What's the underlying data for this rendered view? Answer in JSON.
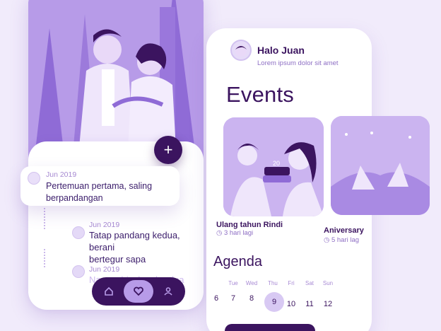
{
  "timeline": {
    "items": [
      {
        "date": "Jun 2019",
        "title_line1": "Pertemuan pertama, saling",
        "title_line2": "berpandangan"
      },
      {
        "date": "Jun 2019",
        "title_line1": "Tatap pandang kedua, berani",
        "title_line2": "bertegur sapa"
      },
      {
        "date": "Jun 2019",
        "title_line1": "Naman bioskop berdua",
        "title_line2": ""
      }
    ],
    "fab_label": "+"
  },
  "profile": {
    "name": "Halo Juan",
    "subtitle": "Lorem ipsum dolor sit amet"
  },
  "events": {
    "title": "Events",
    "cards": [
      {
        "name": "Ulang tahun Rindi",
        "time": "3 hari lagi"
      },
      {
        "name": "Aniversary",
        "time": "5 hari lag"
      }
    ]
  },
  "agenda": {
    "title": "Agenda",
    "days": [
      "Tue",
      "Wed",
      "Thu",
      "Fri",
      "Sat",
      "Sun"
    ],
    "dates": [
      "6",
      "7",
      "8",
      "9",
      "10",
      "11",
      "12"
    ],
    "active_date": "9"
  },
  "nav": {
    "items": [
      "home-icon",
      "heart-icon",
      "person-icon"
    ]
  },
  "colors": {
    "primary": "#3b145f",
    "accent": "#b79be8",
    "background": "#f1ebfb"
  }
}
